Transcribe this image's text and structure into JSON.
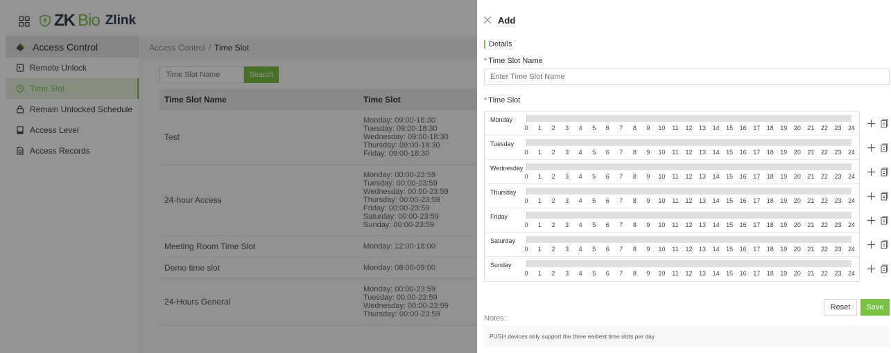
{
  "app": {
    "brand_zk": "ZK",
    "brand_bio": "Bio",
    "brand_product": "Zlink"
  },
  "sidebar": {
    "module": "Access Control",
    "items": [
      {
        "label": "Remote Unlock",
        "icon": "door-unlock-icon",
        "active": false
      },
      {
        "label": "Time Slot",
        "icon": "clock-icon",
        "active": true
      },
      {
        "label": "Remain Unlocked Schedule",
        "icon": "lock-icon",
        "active": false
      },
      {
        "label": "Access Level",
        "icon": "access-level-icon",
        "active": false
      },
      {
        "label": "Access Records",
        "icon": "records-icon",
        "active": false
      }
    ]
  },
  "breadcrumb": {
    "root": "Access Control",
    "separator": "/",
    "current": "Time Slot"
  },
  "search": {
    "placeholder": "Time Slot Name",
    "button": "Search"
  },
  "table": {
    "headers": [
      "Time Slot Name",
      "Time Slot"
    ],
    "rows": [
      {
        "name": "Test",
        "slots": [
          "Monday: 09:00-18:30",
          "Tuesday: 09:00-18:30",
          "Wednesday: 09:00-18:30",
          "Thursday: 09:00-18:30",
          "Friday: 09:00-18:30"
        ]
      },
      {
        "name": "24-hour Access",
        "slots": [
          "Monday: 00:00-23:59",
          "Tuesday: 00:00-23:59",
          "Wednesday: 00:00-23:59",
          "Thursday: 00:00-23:59",
          "Friday: 00:00-23:59",
          "Saturday: 00:00-23:59",
          "Sunday: 00:00-23:59"
        ]
      },
      {
        "name": "Meeting Room Time Slot",
        "slots": [
          "Monday: 12:00-18:00"
        ]
      },
      {
        "name": "Demo time slot",
        "slots": [
          "Monday: 08:00-09:00"
        ]
      },
      {
        "name": "24-Hours General",
        "slots": [
          "Monday: 00:00-23:59",
          "Tuesday: 00:00-23:59",
          "Wednesday: 00:00-23:59",
          "Thursday: 00:00-23:59"
        ]
      }
    ]
  },
  "drawer": {
    "title": "Add",
    "section": "Details",
    "name_label": "Time Slot Name",
    "name_placeholder": "Enter Time Slot Name",
    "slot_label": "Time Slot",
    "required_mark": "*",
    "days": [
      "Monday",
      "Tuesday",
      "Wednesday",
      "Thursday",
      "Friday",
      "Saturday",
      "Sunday"
    ],
    "hours": [
      "0",
      "1",
      "2",
      "3",
      "4",
      "5",
      "6",
      "7",
      "8",
      "9",
      "10",
      "11",
      "12",
      "13",
      "14",
      "15",
      "16",
      "17",
      "18",
      "19",
      "20",
      "21",
      "22",
      "23",
      "24"
    ],
    "reset": "Reset",
    "save": "Save",
    "notes_label": "Notes:",
    "notes_text": "PUSH devices only support the three earliest time slots per day"
  },
  "colors": {
    "accent": "#7ac143",
    "brand_dark": "#2c3e50",
    "required": "#e74c3c"
  }
}
